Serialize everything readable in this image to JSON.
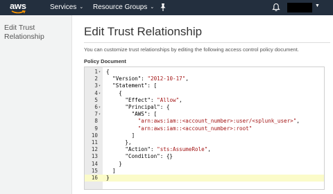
{
  "nav": {
    "logo_text": "aws",
    "services_label": "Services",
    "resource_groups_label": "Resource Groups",
    "chevron": "⌄",
    "pin_icon": "pin-icon",
    "bell_icon": "bell-icon",
    "account_redacted": true,
    "background_color": "#232f3e"
  },
  "sidebar": {
    "title": "Edit Trust Relationship"
  },
  "main": {
    "title": "Edit Trust Relationship",
    "description": "You can customize trust relationships by editing the following access control policy document.",
    "doc_label": "Policy Document"
  },
  "editor": {
    "active_line": 16,
    "lines": [
      {
        "n": "1",
        "fold": true,
        "parts": [
          {
            "t": "{",
            "s": false
          }
        ]
      },
      {
        "n": "2",
        "fold": false,
        "parts": [
          {
            "t": "  \"Version\": ",
            "s": false
          },
          {
            "t": "\"2012-10-17\"",
            "s": true
          },
          {
            "t": ",",
            "s": false
          }
        ]
      },
      {
        "n": "3",
        "fold": true,
        "parts": [
          {
            "t": "  \"Statement\": [",
            "s": false
          }
        ]
      },
      {
        "n": "4",
        "fold": true,
        "parts": [
          {
            "t": "    {",
            "s": false
          }
        ]
      },
      {
        "n": "5",
        "fold": false,
        "parts": [
          {
            "t": "      \"Effect\": ",
            "s": false
          },
          {
            "t": "\"Allow\"",
            "s": true
          },
          {
            "t": ",",
            "s": false
          }
        ]
      },
      {
        "n": "6",
        "fold": true,
        "parts": [
          {
            "t": "      \"Principal\": {",
            "s": false
          }
        ]
      },
      {
        "n": "7",
        "fold": true,
        "parts": [
          {
            "t": "        \"AWS\": [",
            "s": false
          }
        ]
      },
      {
        "n": "8",
        "fold": false,
        "parts": [
          {
            "t": "          ",
            "s": false
          },
          {
            "t": "\"arn:aws:iam::<account_number>:user/<splunk_user>\"",
            "s": true
          },
          {
            "t": ",",
            "s": false
          }
        ]
      },
      {
        "n": "9",
        "fold": false,
        "parts": [
          {
            "t": "          ",
            "s": false
          },
          {
            "t": "\"arn:aws:iam::<account_number>:root\"",
            "s": true
          }
        ]
      },
      {
        "n": "10",
        "fold": false,
        "parts": [
          {
            "t": "        ]",
            "s": false
          }
        ]
      },
      {
        "n": "11",
        "fold": false,
        "parts": [
          {
            "t": "      },",
            "s": false
          }
        ]
      },
      {
        "n": "12",
        "fold": false,
        "parts": [
          {
            "t": "      \"Action\": ",
            "s": false
          },
          {
            "t": "\"sts:AssumeRole\"",
            "s": true
          },
          {
            "t": ",",
            "s": false
          }
        ]
      },
      {
        "n": "13",
        "fold": false,
        "parts": [
          {
            "t": "      \"Condition\": {}",
            "s": false
          }
        ]
      },
      {
        "n": "14",
        "fold": false,
        "parts": [
          {
            "t": "    }",
            "s": false
          }
        ]
      },
      {
        "n": "15",
        "fold": false,
        "parts": [
          {
            "t": "  ]",
            "s": false
          }
        ]
      },
      {
        "n": "16",
        "fold": false,
        "parts": [
          {
            "t": "}",
            "s": false
          }
        ]
      }
    ]
  }
}
